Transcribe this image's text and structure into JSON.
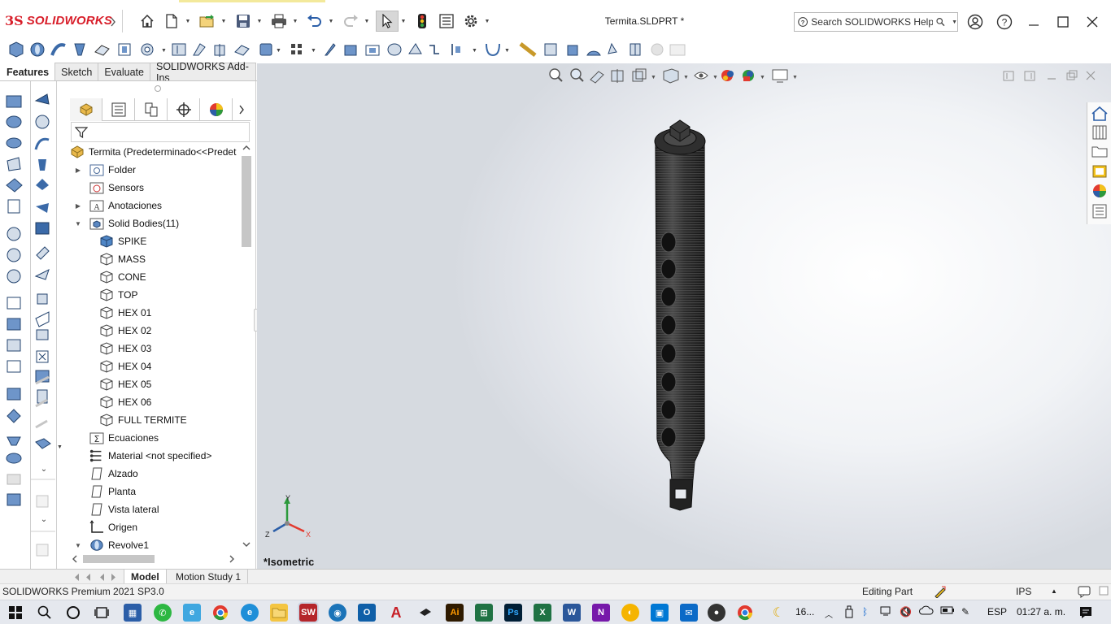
{
  "app": {
    "brand": "SOLIDWORKS",
    "brand_prefix": "3S",
    "document_title": "Termita.SLDPRT *"
  },
  "help_search": {
    "placeholder": "Search SOLIDWORKS Help"
  },
  "command_tabs": [
    "Features",
    "Sketch",
    "Evaluate",
    "SOLIDWORKS Add-Ins"
  ],
  "feature_tree": {
    "root": "Termita  (Predeterminado<<Predet",
    "items": [
      {
        "label": "Folder",
        "icon": "folder-icon",
        "expander": "▶",
        "indent": 0
      },
      {
        "label": "Sensors",
        "icon": "sensors-icon",
        "expander": "",
        "indent": 0
      },
      {
        "label": "Anotaciones",
        "icon": "annotations-icon",
        "expander": "▶",
        "indent": 0
      },
      {
        "label": "Solid Bodies(11)",
        "icon": "solid-bodies-folder-icon",
        "expander": "▼",
        "indent": 0
      },
      {
        "label": "SPIKE",
        "icon": "solid-body-icon",
        "expander": "",
        "indent": 1
      },
      {
        "label": "MASS",
        "icon": "body-outline-icon",
        "expander": "",
        "indent": 1
      },
      {
        "label": "CONE",
        "icon": "body-outline-icon",
        "expander": "",
        "indent": 1
      },
      {
        "label": "TOP",
        "icon": "body-outline-icon",
        "expander": "",
        "indent": 1
      },
      {
        "label": "HEX 01",
        "icon": "body-outline-icon",
        "expander": "",
        "indent": 1
      },
      {
        "label": "HEX 02",
        "icon": "body-outline-icon",
        "expander": "",
        "indent": 1
      },
      {
        "label": "HEX 03",
        "icon": "body-outline-icon",
        "expander": "",
        "indent": 1
      },
      {
        "label": "HEX 04",
        "icon": "body-outline-icon",
        "expander": "",
        "indent": 1
      },
      {
        "label": "HEX 05",
        "icon": "body-outline-icon",
        "expander": "",
        "indent": 1
      },
      {
        "label": "HEX 06",
        "icon": "body-outline-icon",
        "expander": "",
        "indent": 1
      },
      {
        "label": "FULL TERMITE",
        "icon": "body-outline-icon",
        "expander": "",
        "indent": 1
      },
      {
        "label": "Ecuaciones",
        "icon": "equations-icon",
        "expander": "",
        "indent": 0
      },
      {
        "label": "Material <not specified>",
        "icon": "material-icon",
        "expander": "",
        "indent": 0
      },
      {
        "label": "Alzado",
        "icon": "plane-icon",
        "expander": "",
        "indent": 0
      },
      {
        "label": "Planta",
        "icon": "plane-icon",
        "expander": "",
        "indent": 0
      },
      {
        "label": "Vista lateral",
        "icon": "plane-icon",
        "expander": "",
        "indent": 0
      },
      {
        "label": "Origen",
        "icon": "origin-icon",
        "expander": "",
        "indent": 0
      },
      {
        "label": "Revolve1",
        "icon": "revolve-icon",
        "expander": "▼",
        "indent": 0
      }
    ]
  },
  "viewport": {
    "view_orientation": "*Isometric",
    "triad": {
      "x": "X",
      "y": "Y",
      "z": "Z"
    }
  },
  "bottom_tabs": [
    "Model",
    "Motion Study 1"
  ],
  "status": {
    "product": "SOLIDWORKS Premium 2021 SP3.0",
    "mode": "Editing Part",
    "units": "IPS"
  },
  "taskbar": {
    "weather": "16...",
    "language": "ESP",
    "time": "01:27 a. m."
  },
  "colors": {
    "brand_red": "#d81e2a",
    "viewport_bg": "#e6e9ee",
    "model_dark": "#2b2b2b"
  }
}
